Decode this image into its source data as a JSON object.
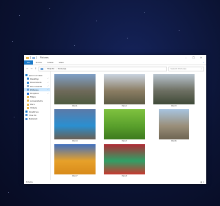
{
  "window": {
    "title": "Pictures",
    "controls": {
      "minimize": "–",
      "maximize": "□",
      "close": "✕"
    }
  },
  "ribbon": {
    "tabs": [
      "File",
      "Home",
      "Share",
      "View"
    ],
    "help_icon": "?"
  },
  "address": {
    "back": "←",
    "forward": "→",
    "up": "↑",
    "path": [
      "This PC",
      "Pictures"
    ],
    "separator": "›",
    "search_placeholder": "Search Pictures",
    "search_icon": "⌕"
  },
  "sidebar": {
    "items": [
      {
        "label": "Quick access",
        "icon": "star-icon",
        "color": "#1979ca",
        "head": true,
        "pin": ""
      },
      {
        "label": "Desktop",
        "icon": "desktop-icon",
        "color": "#2f86d6",
        "pin": "✓"
      },
      {
        "label": "Downloads",
        "icon": "download-icon",
        "color": "#2f86d6",
        "pin": "✓"
      },
      {
        "label": "Documents",
        "icon": "documents-icon",
        "color": "#8aa8c8",
        "pin": "✓"
      },
      {
        "label": "Pictures",
        "icon": "pictures-icon",
        "color": "#6aa0d8",
        "pin": "✓",
        "active": true
      },
      {
        "label": "Dropbox",
        "icon": "dropbox-icon",
        "color": "#1e6fd8",
        "pin": "✓"
      },
      {
        "label": "Maps",
        "icon": "folder-icon",
        "color": "#e8b64c",
        "pin": ""
      },
      {
        "label": "screenshots",
        "icon": "folder-icon",
        "color": "#e8b64c",
        "pin": ""
      },
      {
        "label": "Peru",
        "icon": "folder-icon",
        "color": "#e8b64c",
        "pin": ""
      },
      {
        "label": "Videos",
        "icon": "folder-icon",
        "color": "#e8b64c",
        "pin": ""
      },
      {
        "label": "OneDrive",
        "icon": "onedrive-icon",
        "color": "#1979ca",
        "head": true,
        "pin": ""
      },
      {
        "label": "This PC",
        "icon": "pc-icon",
        "color": "#4a90d9",
        "head": true,
        "pin": ""
      },
      {
        "label": "Network",
        "icon": "network-icon",
        "color": "#4a90d9",
        "head": true,
        "pin": ""
      }
    ]
  },
  "files": [
    {
      "name": "Peru1",
      "colors": [
        "#7fa0c8",
        "#6f6a5a",
        "#4d5a3f"
      ]
    },
    {
      "name": "Peru2",
      "colors": [
        "#c9d3e0",
        "#8b7d63",
        "#5b5a44"
      ]
    },
    {
      "name": "Peru3",
      "colors": [
        "#b8c4cf",
        "#6d6f62",
        "#3f4a38"
      ]
    },
    {
      "name": "Peru4",
      "colors": [
        "#5b7aa8",
        "#2a8fd0",
        "#6a5f52"
      ]
    },
    {
      "name": "Peru5",
      "colors": [
        "#7fc23f",
        "#5aa02c",
        "#3d7a1e"
      ]
    },
    {
      "name": "Peru6",
      "colors": [
        "#a7c4e0",
        "#9a8f7a",
        "#6e6452"
      ]
    },
    {
      "name": "Peru7",
      "colors": [
        "#3f6fc0",
        "#e7a12a",
        "#d88a1a"
      ]
    },
    {
      "name": "Peru8",
      "colors": [
        "#b02a34",
        "#2fa066",
        "#c8372f"
      ]
    }
  ],
  "status": {
    "count": "8 items",
    "views": "▦ ≡"
  }
}
